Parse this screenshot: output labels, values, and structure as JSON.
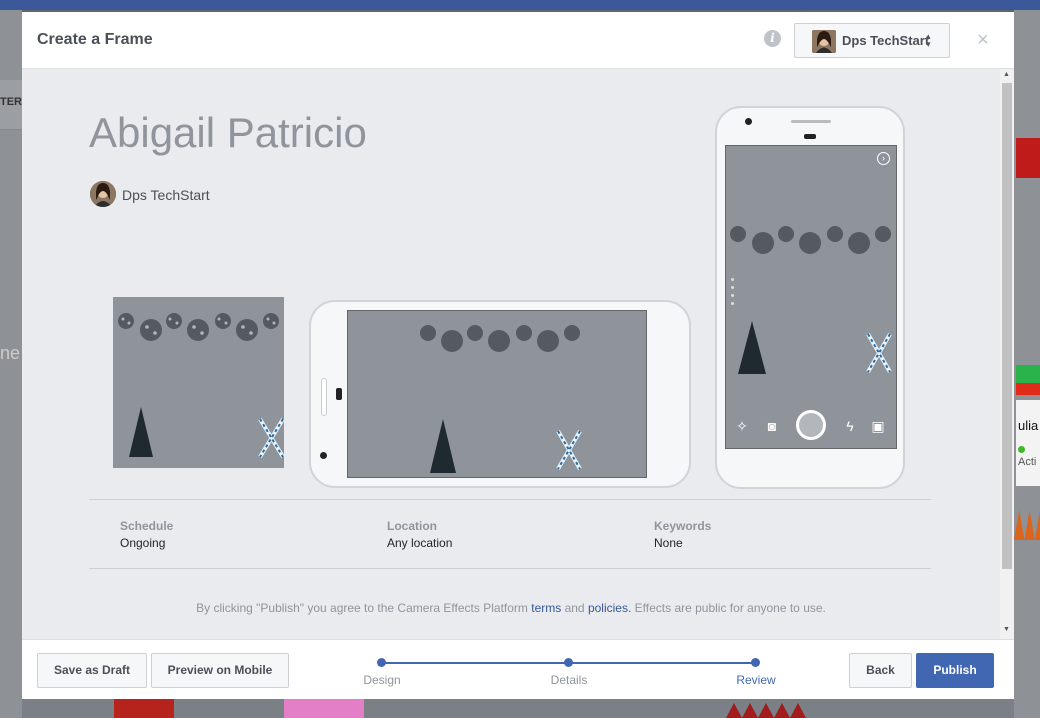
{
  "background": {
    "left_tab_text": "TER",
    "left_text": "ne",
    "right_card_title": "ulia",
    "right_card_status": "Acti"
  },
  "modal": {
    "title": "Create a Frame",
    "page_selector": {
      "label": "Dps TechStart",
      "arrows": "▲▼"
    },
    "close": "×",
    "info": "i"
  },
  "frame": {
    "name": "Abigail Patricio",
    "owner": "Dps TechStart"
  },
  "details": {
    "schedule": {
      "label": "Schedule",
      "value": "Ongoing"
    },
    "location": {
      "label": "Location",
      "value": "Any location"
    },
    "keywords": {
      "label": "Keywords",
      "value": "None"
    }
  },
  "legal": {
    "prefix": "By clicking \"Publish\" you agree to the Camera Effects Platform ",
    "terms": "terms",
    "and": " and ",
    "policies": "policies.",
    "suffix": " Effects are public for anyone to use."
  },
  "footer": {
    "save_draft": "Save as Draft",
    "preview_mobile": "Preview on Mobile",
    "steps": [
      "Design",
      "Details",
      "Review"
    ],
    "active_step": "Review",
    "back": "Back",
    "publish": "Publish"
  },
  "colors": {
    "accent": "#4267b2",
    "link": "#365899",
    "frame_bg": "#8f949b"
  },
  "icons": [
    "info-icon",
    "chevron-updown-icon",
    "close-icon",
    "magic-wand-icon",
    "camera-icon",
    "shutter-icon",
    "flash-icon",
    "gallery-icon",
    "expand-icon"
  ]
}
